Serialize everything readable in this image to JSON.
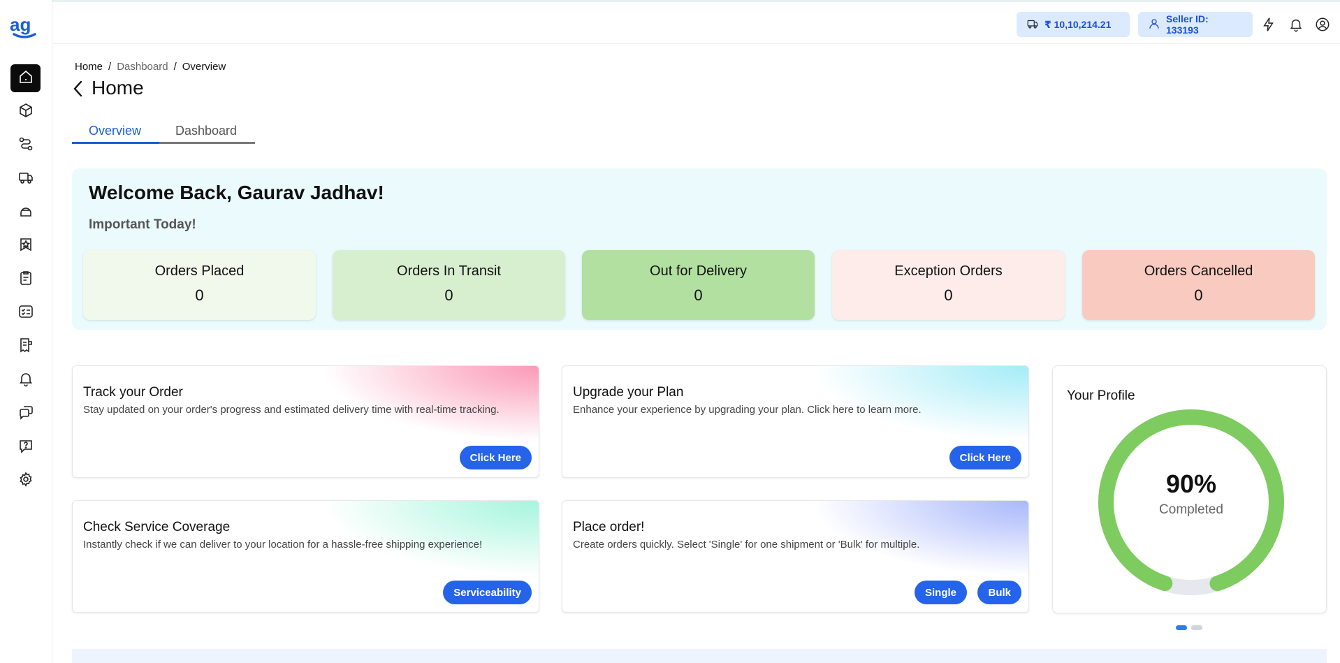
{
  "app": {
    "logo_text": "ag"
  },
  "sidebar": {
    "items": [
      {
        "icon": "home-icon",
        "active": true
      },
      {
        "icon": "box-icon",
        "active": false
      },
      {
        "icon": "route-icon",
        "active": false
      },
      {
        "icon": "truck-icon",
        "active": false
      },
      {
        "icon": "helmet-icon",
        "active": false
      },
      {
        "icon": "badge-star-icon",
        "active": false
      },
      {
        "icon": "clipboard-icon",
        "active": false
      },
      {
        "icon": "checklist-icon",
        "active": false
      },
      {
        "icon": "invoice-icon",
        "active": false
      },
      {
        "icon": "bell-icon",
        "active": false
      },
      {
        "icon": "chat-icon",
        "active": false
      },
      {
        "icon": "help-icon",
        "active": false
      },
      {
        "icon": "settings-icon",
        "active": false
      }
    ]
  },
  "header": {
    "wallet_balance": "₹ 10,10,214.21",
    "seller_id": "Seller ID: 133193",
    "icons": [
      "bolt-icon",
      "bell-icon",
      "user-icon"
    ]
  },
  "breadcrumb": {
    "home": "Home",
    "sep1": "/",
    "dashboard": "Dashboard",
    "sep2": "/",
    "current": "Overview"
  },
  "page": {
    "title": "Home"
  },
  "tabs": [
    {
      "label": "Overview",
      "active": true
    },
    {
      "label": "Dashboard",
      "active": false
    }
  ],
  "welcome": {
    "title": "Welcome Back, Gaurav Jadhav!",
    "subtitle": "Important Today!",
    "stats": [
      {
        "label": "Orders Placed",
        "value": "0",
        "color": "#f1f8ec"
      },
      {
        "label": "Orders In Transit",
        "value": "0",
        "color": "#d8efcf"
      },
      {
        "label": "Out for Delivery",
        "value": "0",
        "color": "#b2e0a0"
      },
      {
        "label": "Exception Orders",
        "value": "0",
        "color": "#fdecea"
      },
      {
        "label": "Orders Cancelled",
        "value": "0",
        "color": "#f8cac0"
      }
    ]
  },
  "cards": {
    "track": {
      "title": "Track your Order",
      "desc": "Stay updated on your order's progress and estimated delivery time with real-time tracking.",
      "button": "Click Here",
      "accent": "#fb9ab8"
    },
    "upgrade": {
      "title": "Upgrade your Plan",
      "desc": "Enhance your experience by upgrading your plan. Click here to learn more.",
      "button": "Click Here",
      "accent": "#a5ecf7"
    },
    "coverage": {
      "title": "Check Service Coverage",
      "desc": "Instantly check if we can deliver to your location for a hassle-free shipping experience!",
      "button": "Serviceability",
      "accent": "#a6f5dc"
    },
    "place": {
      "title": "Place order!",
      "desc": "Create orders quickly. Select 'Single' for one shipment or 'Bulk' for multiple.",
      "button_single": "Single",
      "button_bulk": "Bulk",
      "accent": "#a9b8fb"
    }
  },
  "profile": {
    "title": "Your Profile",
    "percent_text": "90%",
    "percent_value": 90,
    "label": "Completed",
    "color": "#7ecb5f"
  },
  "carousel": {
    "page": 1,
    "total": 2
  }
}
